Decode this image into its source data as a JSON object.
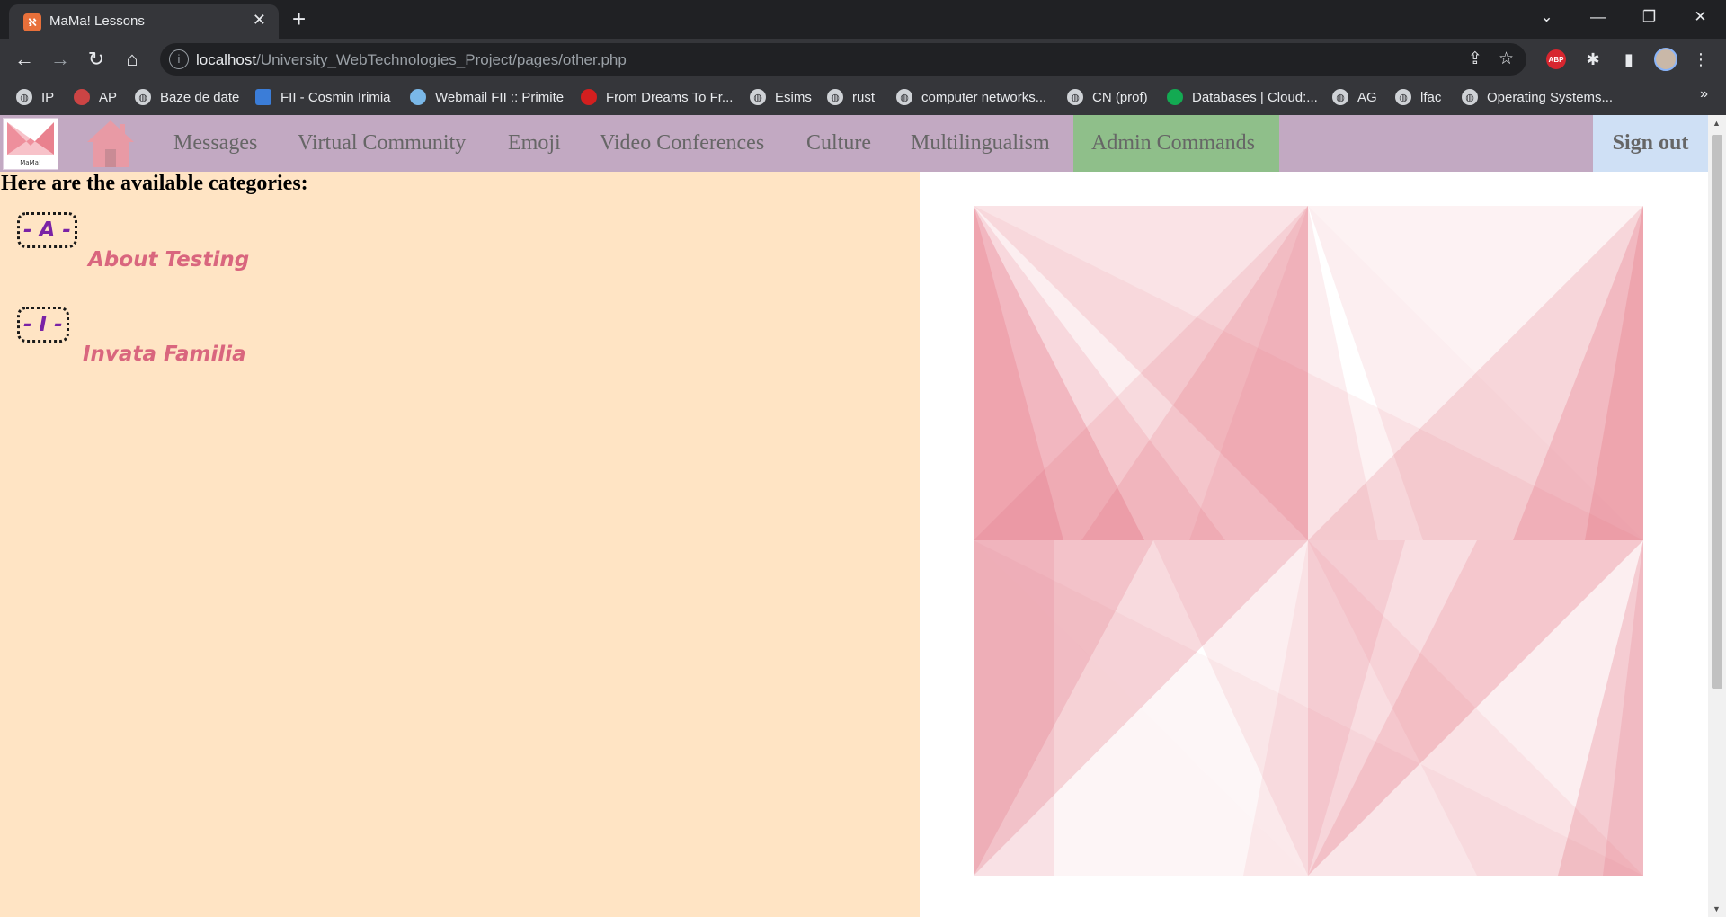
{
  "browser": {
    "tab_title": "MaMa! Lessons",
    "url_host": "localhost",
    "url_path": "/University_WebTechnologies_Project/pages/other.php",
    "bookmarks": [
      "IP",
      "AP",
      "Baze de date",
      "FII - Cosmin Irimia",
      "Webmail FII :: Primite",
      "From Dreams To Fr...",
      "Esims",
      "rust",
      "computer networks...",
      "CN (prof)",
      "Databases | Cloud:...",
      "AG",
      "lfac",
      "Operating Systems..."
    ]
  },
  "nav": {
    "logo_text": "MaMa!",
    "items": [
      "Messages",
      "Virtual Community",
      "Emoji",
      "Video Conferences",
      "Culture",
      "Multilingualism",
      "Admin Commands"
    ],
    "sign_out": "Sign out"
  },
  "content": {
    "heading": "Here are the available categories:",
    "categories": [
      {
        "letter": "- A -",
        "lessons": [
          "About Testing"
        ]
      },
      {
        "letter": "- I -",
        "lessons": [
          "Invata Familia"
        ]
      }
    ]
  },
  "colors": {
    "navbar": "#c2a9c2",
    "admin_highlight": "#8fbf8a",
    "signout": "#cfe0f5",
    "left_panel": "#ffe4c4",
    "letter_text": "#7a22a6",
    "lesson_text": "#d9667e",
    "art_pink": "#e0566a"
  }
}
